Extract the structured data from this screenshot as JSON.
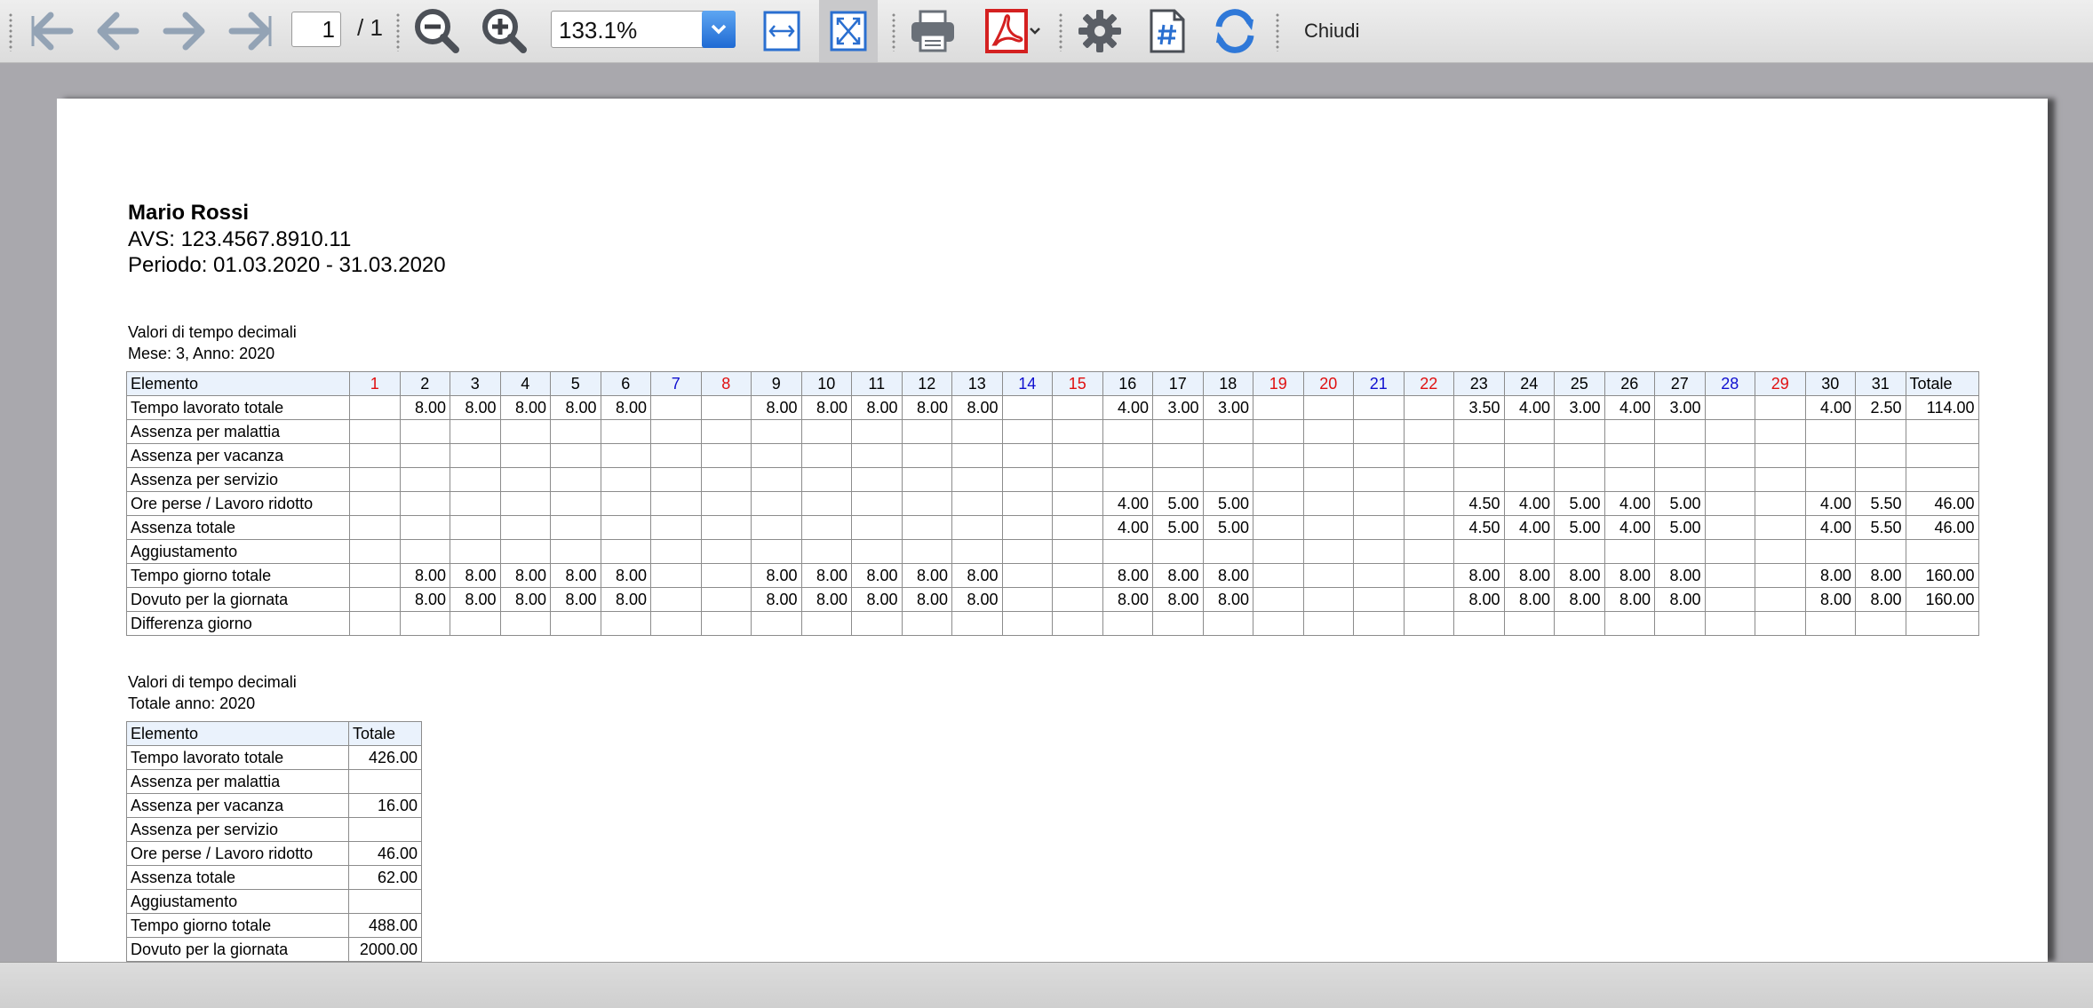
{
  "toolbar": {
    "page_current": "1",
    "page_total": "/ 1",
    "zoom_value": "133.1%",
    "close_label": "Chiudi",
    "icons": [
      "first-page-icon",
      "previous-page-icon",
      "next-page-icon",
      "last-page-icon",
      "zoom-out-icon",
      "zoom-in-icon",
      "fit-width-icon",
      "fit-page-icon",
      "print-icon",
      "pdf-icon",
      "settings-icon",
      "page-number-icon",
      "refresh-icon"
    ]
  },
  "report": {
    "name": "Mario Rossi",
    "avs": "AVS: 123.4567.8910.11",
    "period": "Periodo: 01.03.2020 - 31.03.2020",
    "monthly": {
      "caption1": "Valori di tempo decimali",
      "caption2": "Mese: 3, Anno: 2020",
      "element_header": "Elemento",
      "total_header": "Totale",
      "days": [
        {
          "d": "1",
          "c": "red"
        },
        {
          "d": "2",
          "c": ""
        },
        {
          "d": "3",
          "c": ""
        },
        {
          "d": "4",
          "c": ""
        },
        {
          "d": "5",
          "c": ""
        },
        {
          "d": "6",
          "c": ""
        },
        {
          "d": "7",
          "c": "blue"
        },
        {
          "d": "8",
          "c": "red"
        },
        {
          "d": "9",
          "c": ""
        },
        {
          "d": "10",
          "c": ""
        },
        {
          "d": "11",
          "c": ""
        },
        {
          "d": "12",
          "c": ""
        },
        {
          "d": "13",
          "c": ""
        },
        {
          "d": "14",
          "c": "blue"
        },
        {
          "d": "15",
          "c": "red"
        },
        {
          "d": "16",
          "c": ""
        },
        {
          "d": "17",
          "c": ""
        },
        {
          "d": "18",
          "c": ""
        },
        {
          "d": "19",
          "c": "red"
        },
        {
          "d": "20",
          "c": "red"
        },
        {
          "d": "21",
          "c": "blue"
        },
        {
          "d": "22",
          "c": "red"
        },
        {
          "d": "23",
          "c": ""
        },
        {
          "d": "24",
          "c": ""
        },
        {
          "d": "25",
          "c": ""
        },
        {
          "d": "26",
          "c": ""
        },
        {
          "d": "27",
          "c": ""
        },
        {
          "d": "28",
          "c": "blue"
        },
        {
          "d": "29",
          "c": "red"
        },
        {
          "d": "30",
          "c": ""
        },
        {
          "d": "31",
          "c": ""
        }
      ],
      "rows": [
        {
          "label": "Tempo lavorato totale",
          "v": [
            "",
            "8.00",
            "8.00",
            "8.00",
            "8.00",
            "8.00",
            "",
            "",
            "8.00",
            "8.00",
            "8.00",
            "8.00",
            "8.00",
            "",
            "",
            "4.00",
            "3.00",
            "3.00",
            "",
            "",
            "",
            "",
            "3.50",
            "4.00",
            "3.00",
            "4.00",
            "3.00",
            "",
            "",
            "4.00",
            "2.50"
          ],
          "total": "114.00"
        },
        {
          "label": "Assenza per malattia",
          "v": [
            "",
            "",
            "",
            "",
            "",
            "",
            "",
            "",
            "",
            "",
            "",
            "",
            "",
            "",
            "",
            "",
            "",
            "",
            "",
            "",
            "",
            "",
            "",
            "",
            "",
            "",
            "",
            "",
            "",
            "",
            ""
          ],
          "total": ""
        },
        {
          "label": "Assenza per vacanza",
          "v": [
            "",
            "",
            "",
            "",
            "",
            "",
            "",
            "",
            "",
            "",
            "",
            "",
            "",
            "",
            "",
            "",
            "",
            "",
            "",
            "",
            "",
            "",
            "",
            "",
            "",
            "",
            "",
            "",
            "",
            "",
            ""
          ],
          "total": ""
        },
        {
          "label": "Assenza per servizio",
          "v": [
            "",
            "",
            "",
            "",
            "",
            "",
            "",
            "",
            "",
            "",
            "",
            "",
            "",
            "",
            "",
            "",
            "",
            "",
            "",
            "",
            "",
            "",
            "",
            "",
            "",
            "",
            "",
            "",
            "",
            "",
            ""
          ],
          "total": ""
        },
        {
          "label": "Ore perse / Lavoro ridotto",
          "v": [
            "",
            "",
            "",
            "",
            "",
            "",
            "",
            "",
            "",
            "",
            "",
            "",
            "",
            "",
            "",
            "4.00",
            "5.00",
            "5.00",
            "",
            "",
            "",
            "",
            "4.50",
            "4.00",
            "5.00",
            "4.00",
            "5.00",
            "",
            "",
            "4.00",
            "5.50"
          ],
          "total": "46.00"
        },
        {
          "label": "Assenza totale",
          "v": [
            "",
            "",
            "",
            "",
            "",
            "",
            "",
            "",
            "",
            "",
            "",
            "",
            "",
            "",
            "",
            "4.00",
            "5.00",
            "5.00",
            "",
            "",
            "",
            "",
            "4.50",
            "4.00",
            "5.00",
            "4.00",
            "5.00",
            "",
            "",
            "4.00",
            "5.50"
          ],
          "total": "46.00"
        },
        {
          "label": "Aggiustamento",
          "v": [
            "",
            "",
            "",
            "",
            "",
            "",
            "",
            "",
            "",
            "",
            "",
            "",
            "",
            "",
            "",
            "",
            "",
            "",
            "",
            "",
            "",
            "",
            "",
            "",
            "",
            "",
            "",
            "",
            "",
            "",
            ""
          ],
          "total": ""
        },
        {
          "label": "Tempo giorno totale",
          "v": [
            "",
            "8.00",
            "8.00",
            "8.00",
            "8.00",
            "8.00",
            "",
            "",
            "8.00",
            "8.00",
            "8.00",
            "8.00",
            "8.00",
            "",
            "",
            "8.00",
            "8.00",
            "8.00",
            "",
            "",
            "",
            "",
            "8.00",
            "8.00",
            "8.00",
            "8.00",
            "8.00",
            "",
            "",
            "8.00",
            "8.00"
          ],
          "total": "160.00"
        },
        {
          "label": "Dovuto per la giornata",
          "v": [
            "",
            "8.00",
            "8.00",
            "8.00",
            "8.00",
            "8.00",
            "",
            "",
            "8.00",
            "8.00",
            "8.00",
            "8.00",
            "8.00",
            "",
            "",
            "8.00",
            "8.00",
            "8.00",
            "",
            "",
            "",
            "",
            "8.00",
            "8.00",
            "8.00",
            "8.00",
            "8.00",
            "",
            "",
            "8.00",
            "8.00"
          ],
          "total": "160.00"
        },
        {
          "label": "Differenza giorno",
          "v": [
            "",
            "",
            "",
            "",
            "",
            "",
            "",
            "",
            "",
            "",
            "",
            "",
            "",
            "",
            "",
            "",
            "",
            "",
            "",
            "",
            "",
            "",
            "",
            "",
            "",
            "",
            "",
            "",
            "",
            "",
            ""
          ],
          "total": ""
        }
      ]
    },
    "yearly": {
      "caption1": "Valori di tempo decimali",
      "caption2": "Totale anno: 2020",
      "element_header": "Elemento",
      "total_header": "Totale",
      "rows": [
        {
          "label": "Tempo lavorato totale",
          "total": "426.00"
        },
        {
          "label": "Assenza per malattia",
          "total": ""
        },
        {
          "label": "Assenza per vacanza",
          "total": "16.00"
        },
        {
          "label": "Assenza per servizio",
          "total": ""
        },
        {
          "label": "Ore perse / Lavoro ridotto",
          "total": "46.00"
        },
        {
          "label": "Assenza totale",
          "total": "62.00"
        },
        {
          "label": "Aggiustamento",
          "total": ""
        },
        {
          "label": "Tempo giorno totale",
          "total": "488.00"
        },
        {
          "label": "Dovuto per la giornata",
          "total": "2000.00"
        }
      ]
    }
  }
}
